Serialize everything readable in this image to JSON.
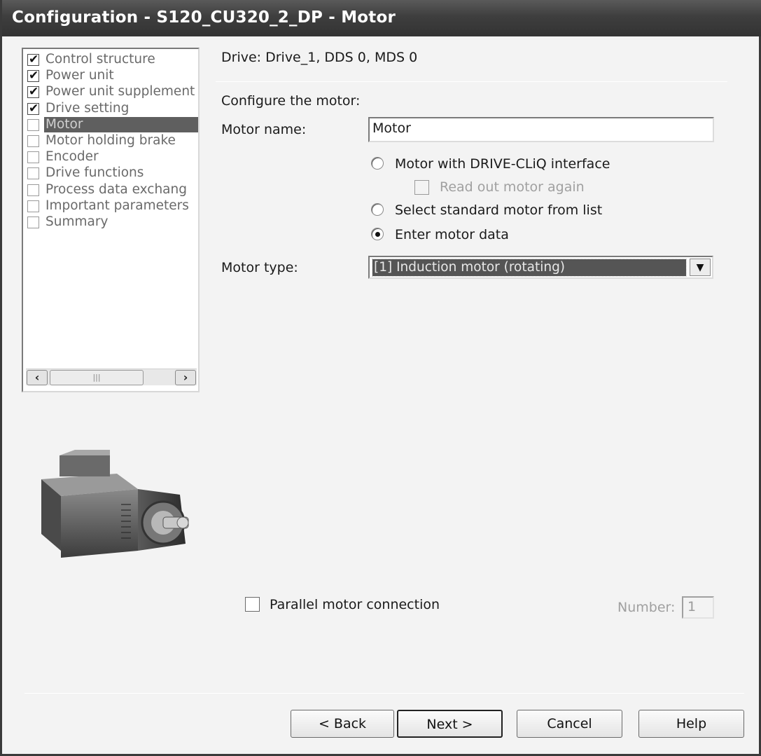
{
  "window": {
    "title": "Configuration - S120_CU320_2_DP - Motor"
  },
  "tree": {
    "items": [
      {
        "label": "Control structure",
        "checked": true
      },
      {
        "label": "Power unit",
        "checked": true
      },
      {
        "label": "Power unit supplement",
        "checked": true
      },
      {
        "label": "Drive setting",
        "checked": true
      },
      {
        "label": "Motor",
        "checked": false,
        "selected": true
      },
      {
        "label": "Motor holding brake",
        "checked": false
      },
      {
        "label": "Encoder",
        "checked": false
      },
      {
        "label": "Drive functions",
        "checked": false
      },
      {
        "label": "Process data exchang",
        "checked": false
      },
      {
        "label": "Important parameters",
        "checked": false
      },
      {
        "label": "Summary",
        "checked": false
      }
    ]
  },
  "header": {
    "drive_info": "Drive: Drive_1, DDS 0, MDS 0"
  },
  "form": {
    "section_label": "Configure the motor:",
    "motor_name_label": "Motor name:",
    "motor_name_value": "Motor",
    "radio_driveicliq": "Motor with DRIVE-CLiQ interface",
    "read_out_again": "Read out motor again",
    "radio_standard": "Select standard motor from list",
    "radio_enter": "Enter motor data",
    "selected_option": "Enter motor data",
    "motor_type_label": "Motor type:",
    "motor_type_value": "[1] Induction motor (rotating)",
    "parallel_label": "Parallel motor connection",
    "number_label": "Number:",
    "number_value": "1"
  },
  "buttons": {
    "back": "< Back",
    "next": "Next >",
    "cancel": "Cancel",
    "help": "Help"
  },
  "icons": {
    "check": "checkmark-icon",
    "scroll_left": "chevron-left-icon",
    "scroll_right": "chevron-right-icon",
    "dropdown": "chevron-down-icon"
  },
  "colors": {
    "title_bg": "#3e3e3e",
    "selection_bg": "#5f5f5f"
  }
}
